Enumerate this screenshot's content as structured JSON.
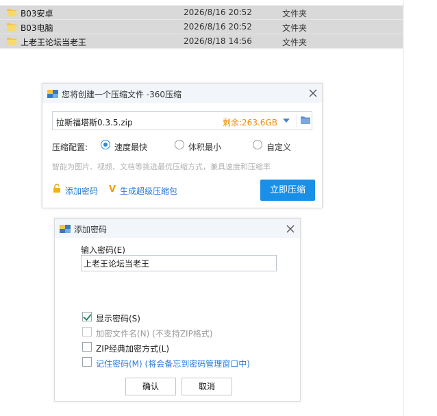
{
  "file_list": [
    {
      "name": "B03安卓",
      "date": "2026/8/16 20:52",
      "type": "文件夹"
    },
    {
      "name": "B03电脑",
      "date": "2026/8/16 20:52",
      "type": "文件夹"
    },
    {
      "name": "上老王论坛当老王",
      "date": "2026/8/18 14:56",
      "type": "文件夹"
    }
  ],
  "zip_dialog": {
    "title": "您将创建一个压缩文件 -360压缩",
    "file_name": "拉斯福塔斯0.3.5.zip",
    "remaining": "剩余:263.6GB",
    "config_label": "压缩配置:",
    "options": [
      "速度最快",
      "体积最小",
      "自定义"
    ],
    "selected_option": "速度最快",
    "hint": "智能为图片、视频、文档等挑选最优压缩方式，兼具速度和压缩率",
    "add_password": "添加密码",
    "super_package": "生成超级压缩包",
    "compress_button": "立即压缩",
    "accent_color": "#1a8fe8",
    "remaining_color": "#f08a00"
  },
  "password_dialog": {
    "title": "添加密码",
    "input_label": "输入密码(E)",
    "password_value": "上老王论坛当老王",
    "checkboxes": [
      {
        "label": "显示密码(S)",
        "checked": true,
        "disabled": false
      },
      {
        "label": "加密文件名(N) (不支持ZIP格式)",
        "checked": false,
        "disabled": true
      },
      {
        "label": "ZIP经典加密方式(L)",
        "checked": false,
        "disabled": false
      },
      {
        "label": "记住密码(M) (将会备忘到密码管理窗口中)",
        "checked": false,
        "disabled": false
      }
    ],
    "ok_button": "确认",
    "cancel_button": "取消"
  }
}
